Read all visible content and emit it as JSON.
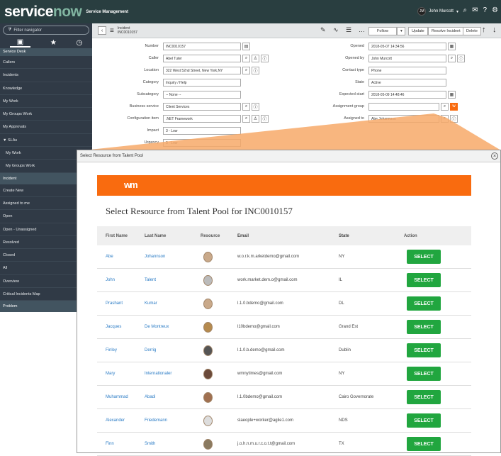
{
  "topbar": {
    "brand_service": "service",
    "brand_now": "now",
    "app_name": "Service Management",
    "user_initials": "JM",
    "user_name": "John Murcott"
  },
  "sidebar": {
    "filter_placeholder": "Filter navigator",
    "section1": "Service Desk",
    "items1": [
      "Callers",
      "Incidents",
      "Knowledge",
      "My Work",
      "My Groups Work",
      "My Approvals",
      "▼ SLAs",
      "My Work",
      "My Groups Work"
    ],
    "section2": "Incident",
    "items2": [
      "Create New",
      "Assigned to me",
      "Open",
      "Open - Unassigned",
      "Resolved",
      "Closed",
      "All",
      "Overview",
      "Critical Incidents Map"
    ],
    "section3": "Problem"
  },
  "header": {
    "record_type": "Incident",
    "record_number": "INC0010157",
    "follow": "Follow",
    "update": "Update",
    "resolve": "Resolve Incident",
    "delete": "Delete"
  },
  "form": {
    "left": [
      {
        "label": "Number",
        "value": "INC0010157"
      },
      {
        "label": "Caller",
        "value": "Abel Tuter"
      },
      {
        "label": "Location",
        "value": "322 West 52nd Street, New York,NY"
      },
      {
        "label": "Category",
        "value": "Inquiry / Help"
      },
      {
        "label": "Subcategory",
        "value": "-- None --"
      },
      {
        "label": "Business service",
        "value": "Client Services"
      },
      {
        "label": "Configuration item",
        "value": ".NET Framework"
      },
      {
        "label": "Impact",
        "value": "3 - Low"
      },
      {
        "label": "Urgency",
        "value": "3 - Low"
      }
    ],
    "right": [
      {
        "label": "Opened",
        "value": "2018-05-07 14:34:56"
      },
      {
        "label": "Opened by",
        "value": "John Murcott"
      },
      {
        "label": "Contact type",
        "value": "Phone"
      },
      {
        "label": "State",
        "value": "Active"
      },
      {
        "label": "Expected start",
        "value": "2018-05-09 14:48:46"
      },
      {
        "label": "Assignment group",
        "value": ""
      },
      {
        "label": "Assigned to",
        "value": "Abe Johannson"
      }
    ]
  },
  "modal": {
    "header": "Select Resource from Talent Pool",
    "banner_logo": "wm",
    "title": "Select Resource from Talent Pool for INC0010157",
    "columns": [
      "First Name",
      "Last Name",
      "Resource",
      "Email",
      "State",
      "Action"
    ],
    "rows": [
      {
        "first": "Abe",
        "last": "Johannson",
        "email": "w.o.r.k.m.arketdemo@gmail.com",
        "state": "NY",
        "action": "SELECT"
      },
      {
        "first": "John",
        "last": "Talent",
        "email": "work.market.dem.o@gmail.com",
        "state": "IL",
        "action": "SELECT"
      },
      {
        "first": "Prashant",
        "last": "Kumar",
        "email": "l.1.0.bdemo@gmail.com",
        "state": "DL",
        "action": "SELECT"
      },
      {
        "first": "Jacques",
        "last": "De Montreux",
        "email": "l10bdemo@gmail.com",
        "state": "Grand Est",
        "action": "SELECT"
      },
      {
        "first": "Finley",
        "last": "Derrig",
        "email": "l.1.0.b.demo@gmail.com",
        "state": "Dublin",
        "action": "SELECT"
      },
      {
        "first": "Mary",
        "last": "Internationaler",
        "email": "wmnytimes@gmail.com",
        "state": "NY",
        "action": "SELECT"
      },
      {
        "first": "Muhammad",
        "last": "Abadi",
        "email": "l.1.0bdemo@gmail.com",
        "state": "Cairo Governorate",
        "action": "SELECT"
      },
      {
        "first": "Alexander",
        "last": "Friedemann",
        "email": "slaeople+worker@agile1.com",
        "state": "NDS",
        "action": "SELECT"
      },
      {
        "first": "Finn",
        "last": "Smith",
        "email": "j.o.h.n.m.u.r.c.o.t.t@gmail.com",
        "state": "TX",
        "action": "SELECT"
      }
    ]
  },
  "colors": {
    "topbar": "#293e40",
    "sidebar": "#303a46",
    "accent_orange": "#f96b0f",
    "select_green": "#21a63f",
    "link_blue": "#2a7bc5"
  }
}
